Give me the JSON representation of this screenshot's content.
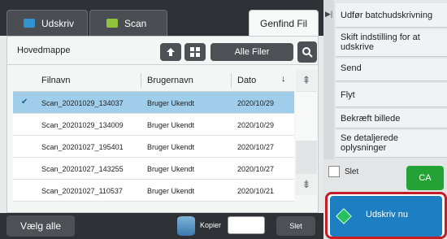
{
  "tabs": {
    "print": "Udskriv",
    "scan": "Scan",
    "find": "Genfind Fil"
  },
  "folder": {
    "label": "Hovedmappe",
    "filter_label": "Alle Filer"
  },
  "table": {
    "headers": [
      "Filnavn",
      "Brugernavn",
      "Dato"
    ],
    "sort_indicator": "↓",
    "rows": [
      {
        "name": "Scan_20201029_134037",
        "user": "Bruger Ukendt",
        "date": "2020/10/29",
        "selected": true
      },
      {
        "name": "Scan_20201029_134009",
        "user": "Bruger Ukendt",
        "date": "2020/10/29",
        "selected": false
      },
      {
        "name": "Scan_20201027_195401",
        "user": "Bruger Ukendt",
        "date": "2020/10/27",
        "selected": false
      },
      {
        "name": "Scan_20201027_143255",
        "user": "Bruger Ukendt",
        "date": "2020/10/27",
        "selected": false
      },
      {
        "name": "Scan_20201027_110537",
        "user": "Bruger Ukendt",
        "date": "2020/10/21",
        "selected": false
      }
    ]
  },
  "bottom": {
    "select_all": "Vælg alle",
    "copies_label": "Kopier",
    "copies_value": "",
    "delete": "Slet"
  },
  "side": {
    "items": [
      "Udfør batchudskrivning",
      "Skift indstilling for at udskrive",
      "Send",
      "Flyt",
      "Bekræft billede",
      "Se detaljerede oplysninger"
    ],
    "delete_checkbox_label": "Slet",
    "ca_label": "CA",
    "print_now": "Udskriv nu"
  },
  "colors": {
    "selected_row": "#9fcdea",
    "ca_button": "#23a336",
    "print_now": "#1d7ec2",
    "highlight_border": "#c31d26"
  },
  "icons": [
    "print-icon",
    "scan-icon",
    "folder-up-icon",
    "grid-view-icon",
    "search-icon",
    "checkmark-icon",
    "sort-down-icon",
    "scroll-up-icon",
    "scroll-down-icon",
    "collapse-arrow-icon",
    "storage-icon",
    "start-icon"
  ]
}
